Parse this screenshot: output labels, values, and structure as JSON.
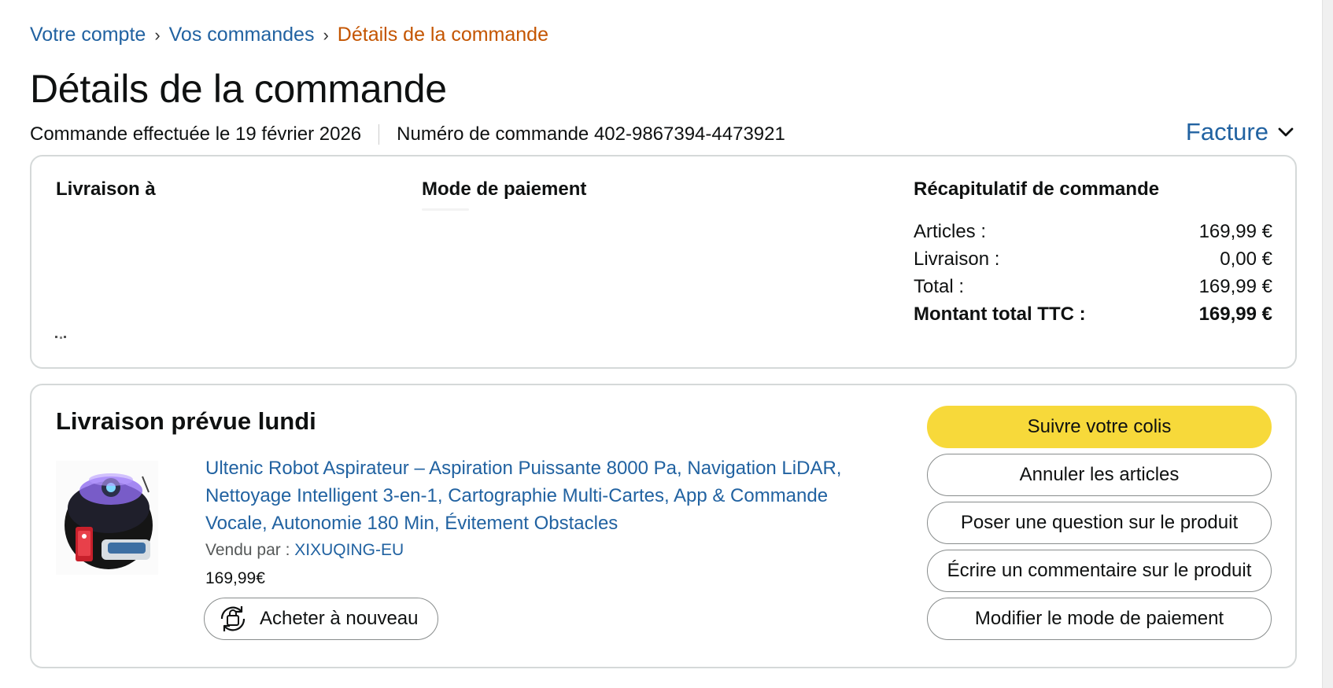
{
  "breadcrumb": {
    "account": "Votre compte",
    "orders": "Vos commandes",
    "current": "Détails de la commande",
    "separator": "›"
  },
  "page": {
    "title": "Détails de la commande",
    "order_date": "Commande effectuée le 19 février 2026",
    "order_number": "Numéro de commande 402-9867394-4473921",
    "invoice_label": "Facture"
  },
  "summary_card": {
    "shipping_title": "Livraison à",
    "payment_title": "Mode de paiement",
    "summary_title": "Récapitulatif de commande",
    "rows": [
      {
        "label": "Articles :",
        "value": "169,99 €"
      },
      {
        "label": "Livraison :",
        "value": "0,00 €"
      },
      {
        "label": "Total :",
        "value": "169,99 €"
      },
      {
        "label": "Montant total TTC :",
        "value": "169,99 €"
      }
    ]
  },
  "delivery": {
    "title": "Livraison prévue lundi",
    "product_title": "Ultenic Robot Aspirateur – Aspiration Puissante 8000 Pa, Navigation LiDAR, Nettoyage Intelligent 3-en-1, Cartographie Multi-Cartes, App & Commande Vocale, Autonomie 180 Min, Évitement Obstacles",
    "sold_by_label": "Vendu par  :",
    "seller": "XIXUQING-EU",
    "price": "169,99€",
    "buy_again": "Acheter à nouveau"
  },
  "actions": {
    "track": "Suivre votre colis",
    "cancel": "Annuler les articles",
    "ask": "Poser une question sur le produit",
    "review": "Écrire un commentaire sur le produit",
    "change_payment": "Modifier le mode de paiement"
  },
  "colors": {
    "link": "#2162a1",
    "breadcrumb_current": "#c45500",
    "primary_button": "#f7d93a",
    "card_border": "#d5d9d9"
  },
  "icons": [
    "chevron-down-icon",
    "buy-again-icon",
    "product-image"
  ]
}
